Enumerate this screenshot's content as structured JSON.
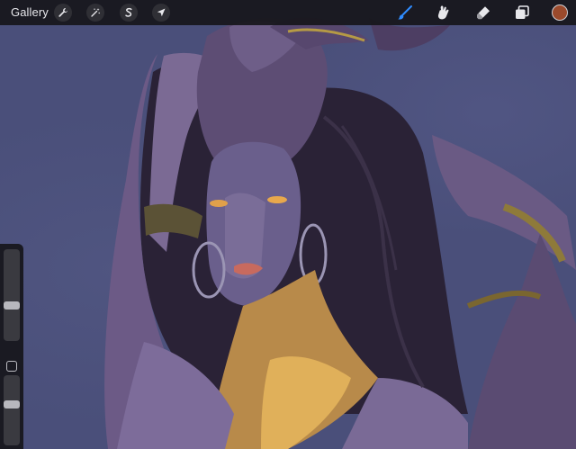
{
  "app": {
    "gallery_label": "Gallery"
  },
  "toolbar": {
    "left_tools": [
      {
        "name": "actions",
        "icon": "wrench-icon"
      },
      {
        "name": "adjustments",
        "icon": "magic-wand-icon"
      },
      {
        "name": "selection",
        "icon": "selection-s-icon"
      },
      {
        "name": "transform",
        "icon": "arrow-cursor-icon"
      }
    ],
    "right_tools": [
      {
        "name": "brush",
        "icon": "brush-icon",
        "active": true
      },
      {
        "name": "smudge",
        "icon": "smudge-icon",
        "active": false
      },
      {
        "name": "eraser",
        "icon": "eraser-icon",
        "active": false
      },
      {
        "name": "layers",
        "icon": "layers-icon",
        "active": false
      }
    ],
    "active_color": "#9b4a2c",
    "accent_color": "#2f8cff"
  },
  "sidebar": {
    "brush_size_level": 0.38,
    "opacity_level": 0.6
  }
}
